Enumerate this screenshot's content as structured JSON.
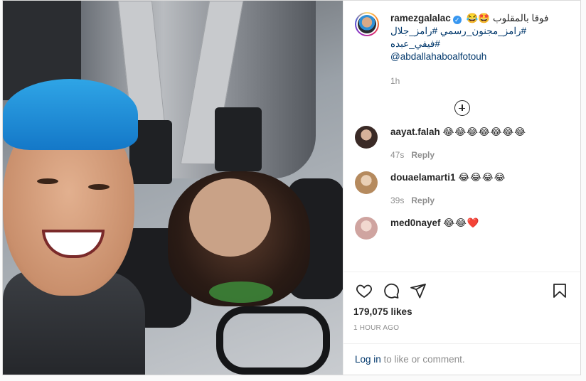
{
  "post": {
    "username": "ramezgalalac",
    "caption_line1": "😂🤩 فوقا بالمقلوب",
    "caption_line2": "#رامز_مجنون_رسمي #رامز_جلال #فيفي_عبده",
    "mention": "@abdallahaboalfotouh",
    "time": "1h"
  },
  "comments": [
    {
      "username": "aayat.falah",
      "text": "😂😂😂😂😂😂😂",
      "time": "47s",
      "reply": "Reply",
      "avatar_color": "#3a2a26"
    },
    {
      "username": "douaelamarti1",
      "text": "😂😂😂😂",
      "time": "39s",
      "reply": "Reply",
      "avatar_color": "#b58a5e"
    },
    {
      "username": "med0nayef",
      "text": "😂😂❤️",
      "time": "",
      "reply": "",
      "avatar_color": "#cfa4a0"
    }
  ],
  "actions": {
    "likes": "179,075 likes",
    "ago": "1 HOUR AGO",
    "login_link": "Log in",
    "login_rest": " to like or comment."
  },
  "colors": {
    "link": "#00376b",
    "verified": "#3897f0",
    "heart": "#ed4956"
  },
  "icons": [
    "heart-icon",
    "comment-icon",
    "share-icon",
    "bookmark-icon",
    "plus-circle-icon",
    "verified-badge-icon"
  ]
}
